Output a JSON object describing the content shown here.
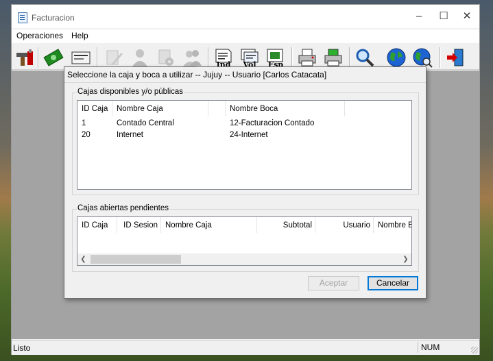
{
  "window": {
    "title": "Facturacion"
  },
  "menu": {
    "items": [
      "Operaciones",
      "Help"
    ]
  },
  "toolbar": {
    "buttons": [
      {
        "icon": "tools-icon"
      },
      {
        "icon": "money-icon"
      },
      {
        "icon": "card-icon"
      },
      {
        "icon": "doc-edit-icon",
        "disabled": true
      },
      {
        "icon": "user-icon",
        "disabled": true
      },
      {
        "icon": "doc-gear-icon",
        "disabled": true
      },
      {
        "icon": "user-group-icon",
        "disabled": true
      },
      {
        "icon": "invoice-ind-icon",
        "label": "Ind"
      },
      {
        "icon": "invoice-vol-icon",
        "label": "Vol"
      },
      {
        "icon": "invoice-esp-icon",
        "label": "Esp"
      },
      {
        "icon": "printer-icon"
      },
      {
        "icon": "printer-green-icon"
      },
      {
        "icon": "search-icon"
      },
      {
        "icon": "globe-icon"
      },
      {
        "icon": "globe-search-icon"
      },
      {
        "icon": "exit-icon"
      }
    ]
  },
  "status": {
    "text": "Listo",
    "num": "NUM"
  },
  "dialog": {
    "title": "Seleccione la caja y boca a utilizar --  Jujuy  -- Usuario [Carlos Catacata]",
    "available": {
      "label": "Cajas disponibles y/o públicas",
      "columns": [
        "ID Caja",
        "Nombre Caja",
        "",
        "Nombre Boca",
        ""
      ],
      "rows": [
        [
          "1",
          "Contado Central",
          "",
          "12-Facturacion Contado"
        ],
        [
          "20",
          "Internet",
          "",
          "24-Internet"
        ]
      ]
    },
    "pending": {
      "label": "Cajas abiertas pendientes",
      "columns": [
        "ID Caja",
        "ID Sesion",
        "Nombre Caja",
        "Subtotal",
        "Usuario",
        "Nombre B"
      ]
    },
    "buttons": {
      "accept": "Aceptar",
      "cancel": "Cancelar"
    }
  },
  "colors": {
    "workspace": "#a3a3a3",
    "accent": "#0078d7"
  }
}
